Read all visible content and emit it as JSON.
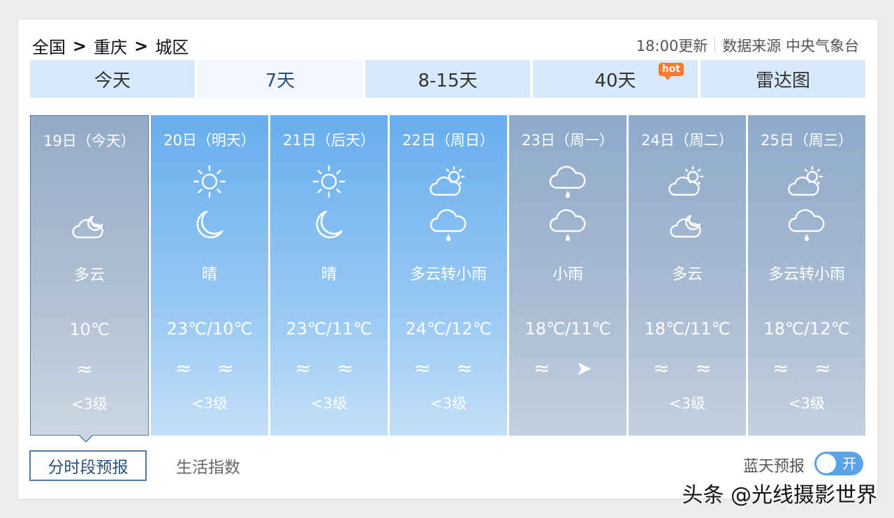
{
  "breadcrumb": {
    "level1": "全国",
    "sep": ">",
    "level2": "重庆",
    "level3": "城区"
  },
  "header": {
    "update_time": "18:00更新",
    "source": "数据来源 中央气象台"
  },
  "tabs": [
    {
      "label": "今天"
    },
    {
      "label": "7天"
    },
    {
      "label": "8-15天"
    },
    {
      "label": "40天",
      "badge": "hot"
    },
    {
      "label": "雷达图"
    }
  ],
  "days": [
    {
      "date": "19日（今天）",
      "day_icon": "",
      "night_icon": "cloud-moon-icon",
      "desc": "多云",
      "temp": "10℃",
      "wind_dir": "≈",
      "wind_level": "<3级"
    },
    {
      "date": "20日（明天）",
      "day_icon": "sun-icon",
      "night_icon": "moon-icon",
      "desc": "晴",
      "temp": "23℃/10℃",
      "wind_dir": "≈ ≈",
      "wind_level": "<3级"
    },
    {
      "date": "21日（后天）",
      "day_icon": "sun-icon",
      "night_icon": "moon-icon",
      "desc": "晴",
      "temp": "23℃/11℃",
      "wind_dir": "≈ ≈",
      "wind_level": "<3级"
    },
    {
      "date": "22日（周日）",
      "day_icon": "cloud-sun-icon",
      "night_icon": "cloud-rain-icon",
      "desc": "多云转小雨",
      "temp": "24℃/12℃",
      "wind_dir": "≈ ≈",
      "wind_level": "<3级"
    },
    {
      "date": "23日（周一）",
      "day_icon": "cloud-rain-icon",
      "night_icon": "cloud-rain-icon",
      "desc": "小雨",
      "temp": "18℃/11℃",
      "wind_dir": "≈ ➤",
      "wind_level": ""
    },
    {
      "date": "24日（周二）",
      "day_icon": "cloud-sun-icon",
      "night_icon": "cloud-moon-icon",
      "desc": "多云",
      "temp": "18℃/11℃",
      "wind_dir": "≈ ≈",
      "wind_level": "<3级"
    },
    {
      "date": "25日（周三）",
      "day_icon": "cloud-sun-icon",
      "night_icon": "cloud-rain-icon",
      "desc": "多云转小雨",
      "temp": "18℃/12℃",
      "wind_dir": "≈ ≈",
      "wind_level": "<3级"
    }
  ],
  "bottom": {
    "tab_active": "分时段预报",
    "tab_other": "生活指数",
    "bluesky_label": "蓝天预报",
    "toggle_label": "开"
  },
  "watermark": "头条 @光线摄影世界"
}
